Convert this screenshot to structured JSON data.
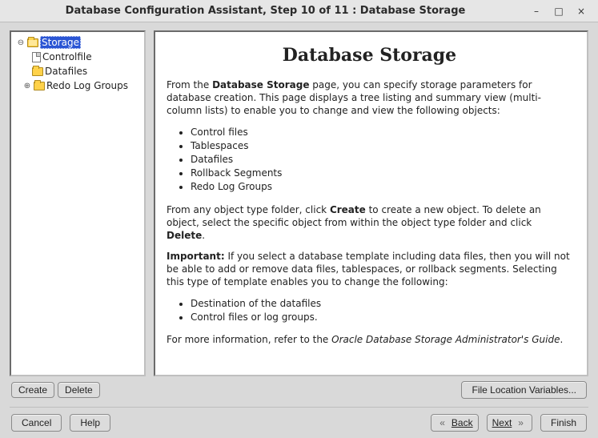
{
  "window": {
    "title": "Database Configuration Assistant, Step 10 of 11 : Database Storage"
  },
  "tree": {
    "root": "Storage",
    "items": [
      {
        "label": "Controlfile",
        "type": "file"
      },
      {
        "label": "Datafiles",
        "type": "folder"
      },
      {
        "label": "Redo Log Groups",
        "type": "folder",
        "expandable": true
      }
    ]
  },
  "content": {
    "heading": "Database Storage",
    "intro_pre": "From the ",
    "intro_bold": "Database Storage",
    "intro_post": " page, you can specify storage parameters for database creation. This page displays a tree listing and summary view (multi-column lists) to enable you to change and view the following objects:",
    "object_list": [
      "Control files",
      "Tablespaces",
      "Datafiles",
      "Rollback Segments",
      "Redo Log Groups"
    ],
    "actions_pre": "From any object type folder, click ",
    "create_word": "Create",
    "actions_mid": " to create a new object. To delete an object, select the specific object from within the object type folder and click ",
    "delete_word": "Delete",
    "actions_post": ".",
    "important_label": "Important:",
    "important_text": " If you select a database template including data files, then you will not be able to add or remove data files, tablespaces, or rollback segments. Selecting this type of template enables you to change the following:",
    "template_list": [
      "Destination of the datafiles",
      "Control files or log groups."
    ],
    "more_info_pre": "For more information, refer to the ",
    "more_info_guide": "Oracle Database Storage Administrator's Guide",
    "more_info_post": "."
  },
  "buttons": {
    "create": "Create",
    "delete": "Delete",
    "file_loc": "File Location Variables...",
    "cancel": "Cancel",
    "help": "Help",
    "back": "Back",
    "next": "Next",
    "finish": "Finish"
  }
}
